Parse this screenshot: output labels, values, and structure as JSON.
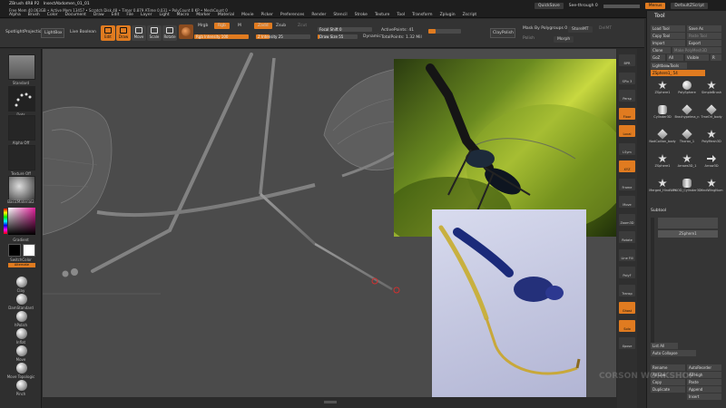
{
  "app": {
    "title": "ZBrush 4R8 P2",
    "document": "InsectAbdomen_01_01",
    "stats": "Free Mem 40.063GB • Active Mem 13457 • Scratch Disk 48 • Timer 0.879 ATime 0.031 • PolyCount 0 KP • MeshCount 0",
    "coords": "1.971 0.932 7.742"
  },
  "menus": [
    "Alpha",
    "Brush",
    "Color",
    "Document",
    "Draw",
    "Edit",
    "File",
    "Layer",
    "Light",
    "Macro",
    "Marker",
    "Material",
    "Movie",
    "Picker",
    "Preferences",
    "Render",
    "Stencil",
    "Stroke",
    "Texture",
    "Tool",
    "Transform",
    "Zplugin",
    "Zscript"
  ],
  "topright": {
    "quicksave": "QuickSave",
    "seethrough": "See-through  0",
    "seethrough_value": 0,
    "menus": "Menus",
    "defaultzscript": "DefaultZScript"
  },
  "toolbar": {
    "spotlight": "SpotlightProjection",
    "lightbox": "LightBox",
    "livebool": "Live Boolean",
    "buttons": [
      "Edit",
      "Draw",
      "Move",
      "Scale",
      "Rotate"
    ],
    "mrgb": "Mrgb",
    "rgb": "Rgb",
    "m": "M",
    "zadd": "Zadd",
    "zsub": "Zsub",
    "zcut": "Zcut",
    "rgb_intensity": "Rgb Intensity 100",
    "rgb_intensity_value": 100,
    "z_intensity": "Z Intensity 25",
    "z_intensity_value": 25,
    "focal_shift": "Focal Shift 0",
    "focal_shift_value": 0,
    "draw_size": "Draw Size 55",
    "draw_size_value": 55,
    "dynamic": "Dynamic",
    "active_points": "ActivePoints: 41",
    "total_points": "TotalPoints: 1.32 Mil",
    "claypolish": "ClayPolish",
    "mask_by_poly": "Mask By Polygroups 0",
    "storemt": "StoreMT",
    "delmt": "DelMT",
    "polish": "Polish",
    "morph": "Morph"
  },
  "leftpanel": {
    "brush": "Standard",
    "stroke": "Dots",
    "alpha": "Alpha Off",
    "texture": "Texture Off",
    "material": "BasicMaterial2",
    "gradient": "Gradient",
    "switchcolor": "SwitchColor",
    "alternate": "Alternate",
    "brushes": [
      "Clay",
      "DamStandard",
      "hPolish",
      "Inflat",
      "Move",
      "Move Topologic",
      "Pinch"
    ]
  },
  "righttools": [
    "BPR",
    "SPix 3",
    "Persp",
    "Floor",
    "Local",
    "LSym",
    "XYZ",
    "Frame",
    "Move",
    "Zoom3D",
    "Rotate",
    "Line Fill",
    "PolyF",
    "Transp",
    "Ghost",
    "Solo",
    "Xpose"
  ],
  "rightpanel": {
    "title": "Tool",
    "load": "Load Tool",
    "save": "Save As",
    "copy": "Copy Tool",
    "paste": "Paste Tool",
    "import": "Import",
    "export": "Export",
    "clone": "Clone",
    "make": "Make PolyMesh3D",
    "goz": "GoZ",
    "all": "All",
    "visible": "Visible",
    "r": "R",
    "lightbox_tools": "Lightbox▸Tools",
    "zsphere": "ZSphere1_  54",
    "tools": [
      "ZSphere1",
      "PolySphere",
      "SimpleBrush",
      "Cylinder3D",
      "Brachypelma_n",
      "TmeOri_body",
      "NodCoilion_body",
      "Thorax_1",
      "PolyMesh3D",
      "ZSphere1",
      "Arrows3D_1",
      "Arrow3D",
      "Merged_HindWin",
      "FKOD_Cylinder3D",
      "HindWingNum"
    ],
    "subtool": "Subtool",
    "subtool_item": "ZSphere1",
    "list_all": "List All",
    "auto_collapse": "Auto Collapse",
    "rename": "Rename",
    "autoreorder": "AutoReorder",
    "all_low": "All Low",
    "all_high": "All High",
    "copy_btn": "Copy",
    "paste_btn": "Paste",
    "duplicate": "Duplicate",
    "append": "Append",
    "insert": "Insert"
  },
  "watermark": "CORSON WORKSHOP",
  "colors": {
    "accent": "#e07b20",
    "panel": "#353535",
    "viewport": "#4b4b4b"
  }
}
